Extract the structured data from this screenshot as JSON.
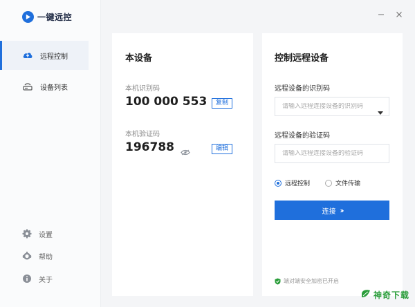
{
  "app": {
    "name": "一键远控"
  },
  "sidebar": {
    "items": [
      {
        "label": "远程控制",
        "icon": "cloud-upload-icon"
      },
      {
        "label": "设备列表",
        "icon": "device-list-icon"
      }
    ],
    "footer": [
      {
        "label": "设置",
        "icon": "gear-icon"
      },
      {
        "label": "帮助",
        "icon": "help-icon"
      },
      {
        "label": "关于",
        "icon": "info-icon"
      }
    ]
  },
  "local_device": {
    "title": "本设备",
    "id_label": "本机识别码",
    "id_value": "100 000 553",
    "copy_label": "复制",
    "code_label": "本机验证码",
    "code_value": "196788",
    "edit_label": "编辑"
  },
  "remote": {
    "title": "控制远程设备",
    "id_label": "远程设备的识别码",
    "id_placeholder": "请输入远程连接设备的识别码",
    "code_label": "远程设备的验证码",
    "code_placeholder": "请输入远程连接设备的验证码",
    "mode_control": "远程控制",
    "mode_file": "文件传输",
    "connect_label": "连接",
    "security_note": "端对端安全加密已开启"
  },
  "watermark": "神奇下载",
  "colors": {
    "accent": "#1f6fdc",
    "security_green": "#2a9d3a"
  }
}
